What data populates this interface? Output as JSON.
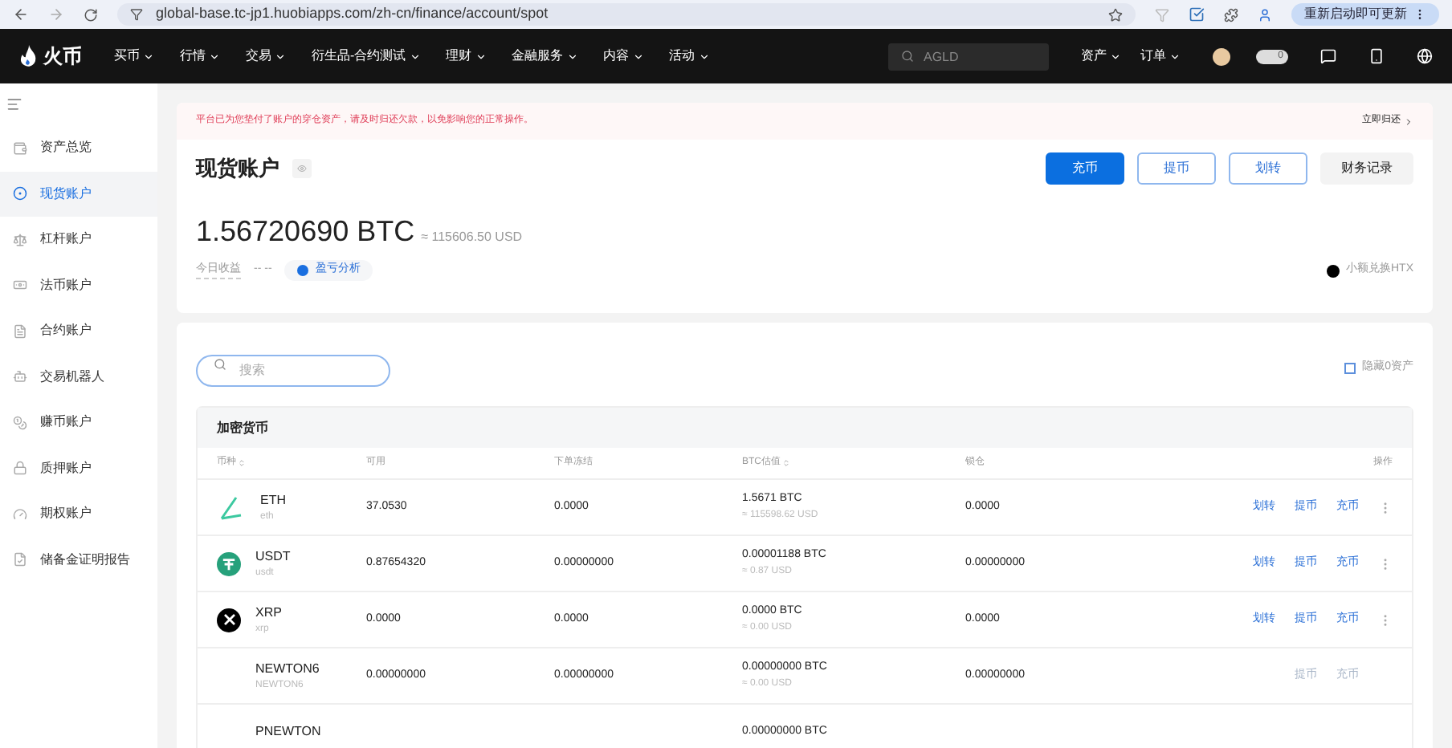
{
  "browser": {
    "url": "global-base.tc-jp1.huobiapps.com/zh-cn/finance/account/spot",
    "update_button": "重新启动即可更新"
  },
  "nav": {
    "logo": "火币",
    "menu": [
      {
        "label": "买币"
      },
      {
        "label": "行情"
      },
      {
        "label": "交易"
      },
      {
        "label": "衍生品-合约测试"
      },
      {
        "label": "理财"
      },
      {
        "label": "金融服务"
      },
      {
        "label": "内容"
      },
      {
        "label": "活动"
      }
    ],
    "search": {
      "placeholder": "AGLD"
    },
    "right_menu": [
      {
        "label": "资产"
      },
      {
        "label": "订单"
      }
    ],
    "toggle_badge": "0"
  },
  "sidebar": {
    "items": [
      {
        "label": "资产总览",
        "selected": false
      },
      {
        "label": "现货账户",
        "selected": true
      },
      {
        "label": "杠杆账户",
        "selected": false
      },
      {
        "label": "法币账户",
        "selected": false
      },
      {
        "label": "合约账户",
        "selected": false
      },
      {
        "label": "交易机器人",
        "selected": false
      },
      {
        "label": "赚币账户",
        "selected": false
      },
      {
        "label": "质押账户",
        "selected": false
      },
      {
        "label": "期权账户",
        "selected": false
      },
      {
        "label": "储备金证明报告",
        "selected": false
      }
    ]
  },
  "notice": {
    "text": "平台已为您垫付了账户的穿仓资产，请及时归还欠款，以免影响您的正常操作。",
    "action": "立即归还"
  },
  "account": {
    "title": "现货账户",
    "buttons": [
      {
        "label": "充币",
        "kind": "primary"
      },
      {
        "label": "提币",
        "kind": "outline"
      },
      {
        "label": "划转",
        "kind": "outline"
      },
      {
        "label": "财务记录",
        "kind": "plain"
      }
    ],
    "balance": "1.56720690 BTC",
    "balance_usd": "≈ 115606.50 USD",
    "today_label": "今日收益",
    "today_value": "-- --",
    "analysis": "盈亏分析",
    "convert": "小额兑换HTX"
  },
  "assets": {
    "search": {
      "placeholder": "搜索"
    },
    "hide_zero": {
      "label": "隐藏0资产",
      "checked": false
    },
    "section": "加密货币",
    "columns": [
      "币种",
      "可用",
      "下单冻结",
      "BTC估值",
      "锁仓",
      "操作"
    ],
    "rows": [
      {
        "symbol": "ETH",
        "name": "eth",
        "available": "37.0530",
        "frozen": "0.0000",
        "btc": "1.5671 BTC",
        "usd": "≈ 115598.62 USD",
        "locked": "0.0000",
        "actions": [
          {
            "label": "划转",
            "disabled": false
          },
          {
            "label": "提币",
            "disabled": false
          },
          {
            "label": "充币",
            "disabled": false
          }
        ],
        "more": true
      },
      {
        "symbol": "USDT",
        "name": "usdt",
        "available": "0.87654320",
        "frozen": "0.00000000",
        "btc": "0.00001188 BTC",
        "usd": "≈ 0.87 USD",
        "locked": "0.00000000",
        "actions": [
          {
            "label": "划转",
            "disabled": false
          },
          {
            "label": "提币",
            "disabled": false
          },
          {
            "label": "充币",
            "disabled": false
          }
        ],
        "more": true
      },
      {
        "symbol": "XRP",
        "name": "xrp",
        "available": "0.0000",
        "frozen": "0.0000",
        "btc": "0.0000 BTC",
        "usd": "≈ 0.00 USD",
        "locked": "0.0000",
        "actions": [
          {
            "label": "划转",
            "disabled": false
          },
          {
            "label": "提币",
            "disabled": false
          },
          {
            "label": "充币",
            "disabled": false
          }
        ],
        "more": true
      },
      {
        "symbol": "NEWTON6",
        "name": "NEWTON6",
        "available": "0.00000000",
        "frozen": "0.00000000",
        "btc": "0.00000000 BTC",
        "usd": "≈ 0.00 USD",
        "locked": "0.00000000",
        "actions": [
          {
            "label": "提币",
            "disabled": true
          },
          {
            "label": "充币",
            "disabled": true
          }
        ],
        "more": false
      },
      {
        "symbol": "PNEWTON",
        "btc": "0.00000000 BTC",
        "actions": [],
        "more": false
      }
    ]
  }
}
